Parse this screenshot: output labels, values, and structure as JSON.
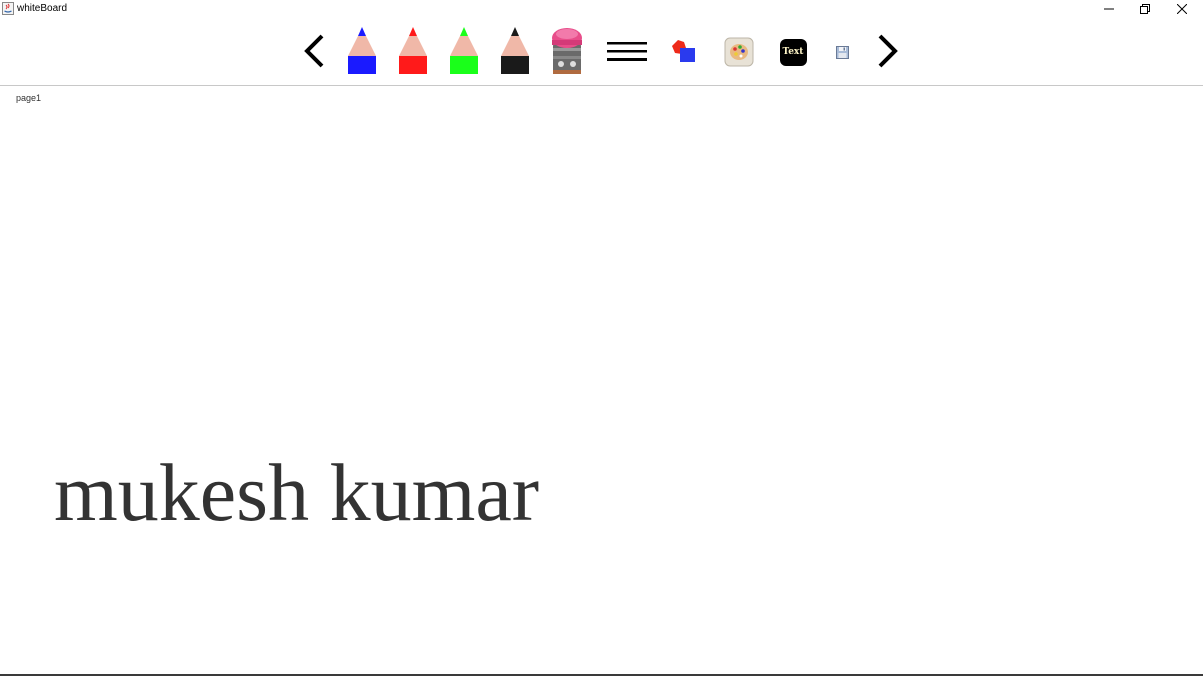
{
  "window": {
    "title": "whiteBoard",
    "controls": {
      "minimize_icon": "minimize-icon",
      "restore_icon": "restore-icon",
      "close_icon": "close-icon"
    }
  },
  "toolbar": {
    "tools": [
      {
        "name": "previous-page",
        "icon": "chevron-left-icon"
      },
      {
        "name": "blue-pencil",
        "icon": "pencil-icon",
        "color": "#1a1aff"
      },
      {
        "name": "red-pencil",
        "icon": "pencil-icon",
        "color": "#ff1a1a"
      },
      {
        "name": "green-pencil",
        "icon": "pencil-icon",
        "color": "#1aff1a"
      },
      {
        "name": "black-pencil",
        "icon": "pencil-icon",
        "color": "#1a1a1a"
      },
      {
        "name": "eraser",
        "icon": "eraser-icon",
        "color": "#e84d8a"
      },
      {
        "name": "line-width",
        "icon": "lines-icon"
      },
      {
        "name": "shapes",
        "icon": "shapes-icon"
      },
      {
        "name": "color-palette",
        "icon": "palette-icon"
      },
      {
        "name": "text-tool",
        "icon": "text-icon",
        "label": "Text"
      },
      {
        "name": "save",
        "icon": "floppy-disk-icon"
      },
      {
        "name": "next-page",
        "icon": "chevron-right-icon"
      }
    ]
  },
  "canvas": {
    "page_label": "page1",
    "text": "mukesh kumar",
    "text_color": "#333333"
  }
}
